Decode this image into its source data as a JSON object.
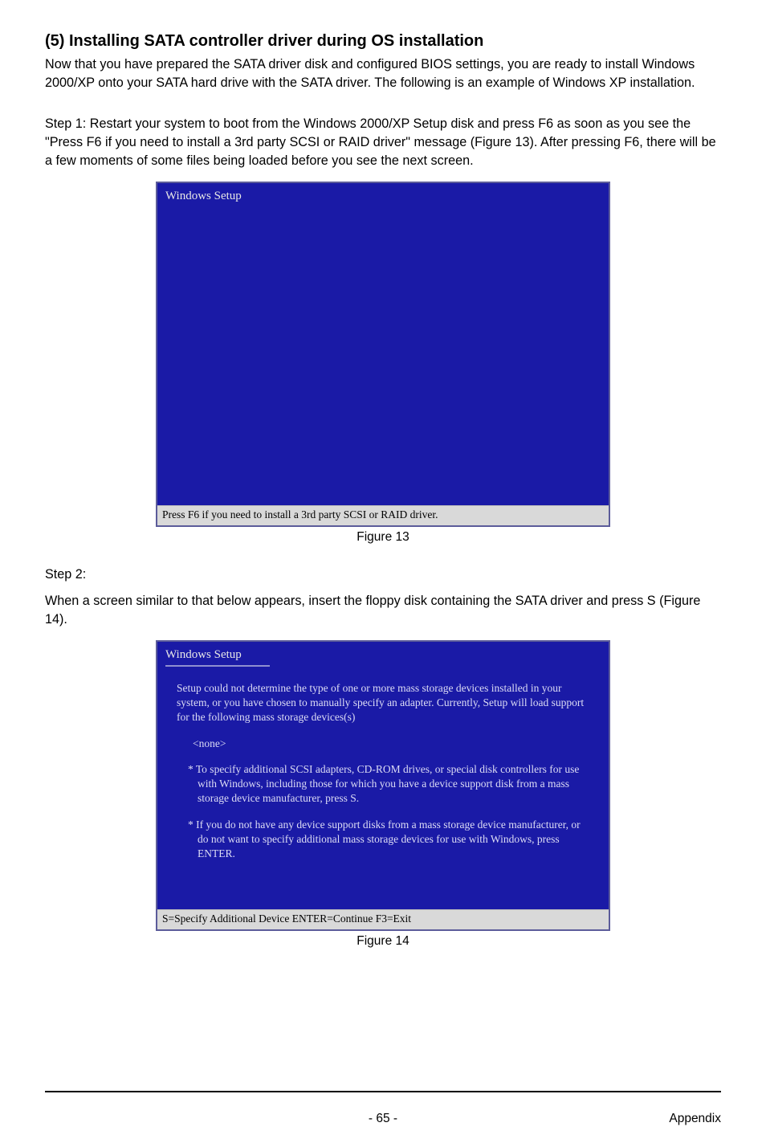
{
  "heading": "(5) Installing SATA controller driver during OS installation",
  "intro1": "Now that you have prepared the SATA driver disk and configured BIOS settings, you are ready to install Windows 2000/XP onto your SATA hard drive with the SATA driver. The following is an example of Windows XP installation.",
  "step1": "Step 1: Restart your system to boot from the Windows 2000/XP Setup disk and press F6 as soon as you see the \"Press F6 if you need to install a 3rd party SCSI or RAID driver\" message (Figure 13).  After pressing F6, there will be a few moments of some files being loaded before you see the next screen.",
  "fig13": {
    "title": "Windows Setup",
    "footer": "Press F6 if you need to install  a 3rd party SCSI or RAID driver.",
    "caption": "Figure 13"
  },
  "step2_label": "Step 2:",
  "step2_text": "When a screen similar to that below appears, insert the floppy disk containing the SATA driver and press S (Figure 14).",
  "fig14": {
    "title": "Windows Setup",
    "intro": "Setup could not determine the type of one or more mass storage devices installed in your system, or you have chosen to manually specify an adapter. Currently, Setup will load support for the following mass storage devices(s)",
    "none": "<none>",
    "b1": "* To specify additional SCSI adapters, CD-ROM drives, or special disk  controllers for use with Windows, including those for which you have a device support disk from a mass storage device manufacturer, press S.",
    "b2": "* If you do not have any device support disks from a mass storage device manufacturer, or do not want to specify additional mass storage devices for use with Windows, press ENTER.",
    "footer": "S=Specify Additional Device   ENTER=Continue   F3=Exit",
    "caption": "Figure 14"
  },
  "footer": {
    "page": "- 65 -",
    "section": "Appendix"
  }
}
